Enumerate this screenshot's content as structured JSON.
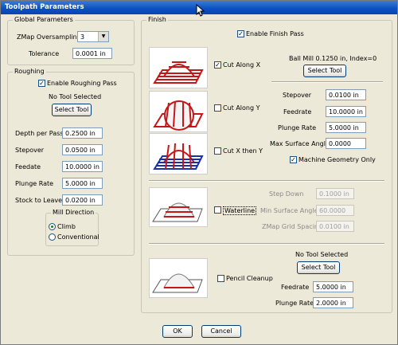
{
  "window": {
    "title": "Toolpath Parameters"
  },
  "global": {
    "group_title": "Global Parameters",
    "zmap_label": "ZMap Oversampling",
    "zmap_value": "3",
    "tolerance_label": "Tolerance",
    "tolerance_value": "0.0001 in"
  },
  "roughing": {
    "group_title": "Roughing",
    "enable_label": "Enable Roughing Pass",
    "enable_checked": true,
    "tool_status": "No Tool Selected",
    "select_tool": "Select Tool",
    "fields": [
      {
        "label": "Depth per Pass",
        "value": "0.2500 in"
      },
      {
        "label": "Stepover",
        "value": "0.0500 in"
      },
      {
        "label": "Feedate",
        "value": "10.0000 in"
      },
      {
        "label": "Plunge Rate",
        "value": "5.0000 in"
      },
      {
        "label": "Stock to Leave",
        "value": "0.0200 in"
      }
    ],
    "mill_direction": {
      "title": "Mill Direction",
      "options": [
        "Climb",
        "Conventional"
      ],
      "selected": "Climb"
    }
  },
  "finish": {
    "group_title": "Finish",
    "enable_label": "Enable Finish Pass",
    "enable_checked": true,
    "tool_info": "Ball Mill 0.1250 in, Index=0",
    "select_tool": "Select Tool",
    "cut_options": [
      {
        "label": "Cut Along X",
        "checked": true
      },
      {
        "label": "Cut Along Y",
        "checked": false
      },
      {
        "label": "Cut X then Y",
        "checked": false
      }
    ],
    "fields": [
      {
        "label": "Stepover",
        "value": "0.0100 in"
      },
      {
        "label": "Feedrate",
        "value": "10.0000 in"
      },
      {
        "label": "Plunge Rate",
        "value": "5.0000 in"
      },
      {
        "label": "Max Surface Angle",
        "value": "0.0000"
      }
    ],
    "machine_geometry_label": "Machine Geometry Only",
    "machine_geometry_checked": true,
    "waterline": {
      "label": "Waterline",
      "checked": false,
      "fields": [
        {
          "label": "Step Down",
          "value": "0.1000 in"
        },
        {
          "label": "Min Surface Angle",
          "value": "60.0000"
        },
        {
          "label": "ZMap Grid Spacing",
          "value": "0.0100 in"
        }
      ]
    },
    "pencil": {
      "label": "Pencil Cleanup",
      "checked": false,
      "tool_status": "No Tool Selected",
      "select_tool": "Select Tool",
      "fields": [
        {
          "label": "Feedrate",
          "value": "5.0000 in"
        },
        {
          "label": "Plunge Rate",
          "value": "2.0000 in"
        }
      ]
    }
  },
  "footer": {
    "ok": "OK",
    "cancel": "Cancel"
  },
  "colors": {
    "red": "#c41818",
    "blue": "#1a2fa8",
    "titlebar": "#0a4fc0"
  }
}
